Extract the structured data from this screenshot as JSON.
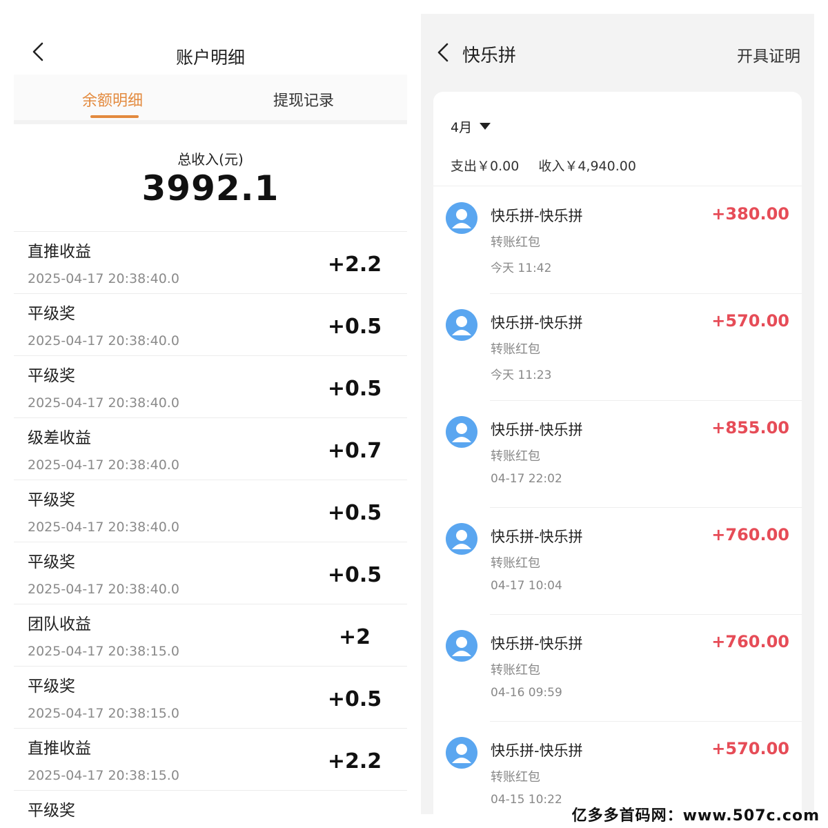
{
  "left_screen": {
    "title": "账户明细",
    "tabs": [
      {
        "label": "余额明细",
        "active": true
      },
      {
        "label": "提现记录",
        "active": false
      }
    ],
    "total_label": "总收入(元)",
    "total_value": "3992.1",
    "rows": [
      {
        "name": "直推收益",
        "time": "2025-04-17 20:38:40.0",
        "amount": "+2.2"
      },
      {
        "name": "平级奖",
        "time": "2025-04-17 20:38:40.0",
        "amount": "+0.5"
      },
      {
        "name": "平级奖",
        "time": "2025-04-17 20:38:40.0",
        "amount": "+0.5"
      },
      {
        "name": "级差收益",
        "time": "2025-04-17 20:38:40.0",
        "amount": "+0.7"
      },
      {
        "name": "平级奖",
        "time": "2025-04-17 20:38:40.0",
        "amount": "+0.5"
      },
      {
        "name": "平级奖",
        "time": "2025-04-17 20:38:40.0",
        "amount": "+0.5"
      },
      {
        "name": "团队收益",
        "time": "2025-04-17 20:38:15.0",
        "amount": "+2"
      },
      {
        "name": "平级奖",
        "time": "2025-04-17 20:38:15.0",
        "amount": "+0.5"
      },
      {
        "name": "直推收益",
        "time": "2025-04-17 20:38:15.0",
        "amount": "+2.2"
      },
      {
        "name": "平级奖",
        "time": "",
        "amount": ""
      }
    ],
    "accent_color": "#e38a3e"
  },
  "right_screen": {
    "title": "快乐拼",
    "certificate_label": "开具证明",
    "month": "4月",
    "expense": "支出￥0.00",
    "income": "收入￥4,940.00",
    "transactions": [
      {
        "name": "快乐拼-快乐拼",
        "type": "转账红包",
        "time": "今天 11:42",
        "amount": "+380.00"
      },
      {
        "name": "快乐拼-快乐拼",
        "type": "转账红包",
        "time": "今天 11:23",
        "amount": "+570.00"
      },
      {
        "name": "快乐拼-快乐拼",
        "type": "转账红包",
        "time": "04-17 22:02",
        "amount": "+855.00"
      },
      {
        "name": "快乐拼-快乐拼",
        "type": "转账红包",
        "time": "04-17 10:04",
        "amount": "+760.00"
      },
      {
        "name": "快乐拼-快乐拼",
        "type": "转账红包",
        "time": "04-16 09:59",
        "amount": "+760.00"
      },
      {
        "name": "快乐拼-快乐拼",
        "type": "转账红包",
        "time": "04-15 10:22",
        "amount": "+570.00"
      }
    ],
    "amount_color": "#e64c57",
    "avatar_color": "#5aa6f0"
  },
  "watermark": "亿多多首码网：www.507c.com"
}
